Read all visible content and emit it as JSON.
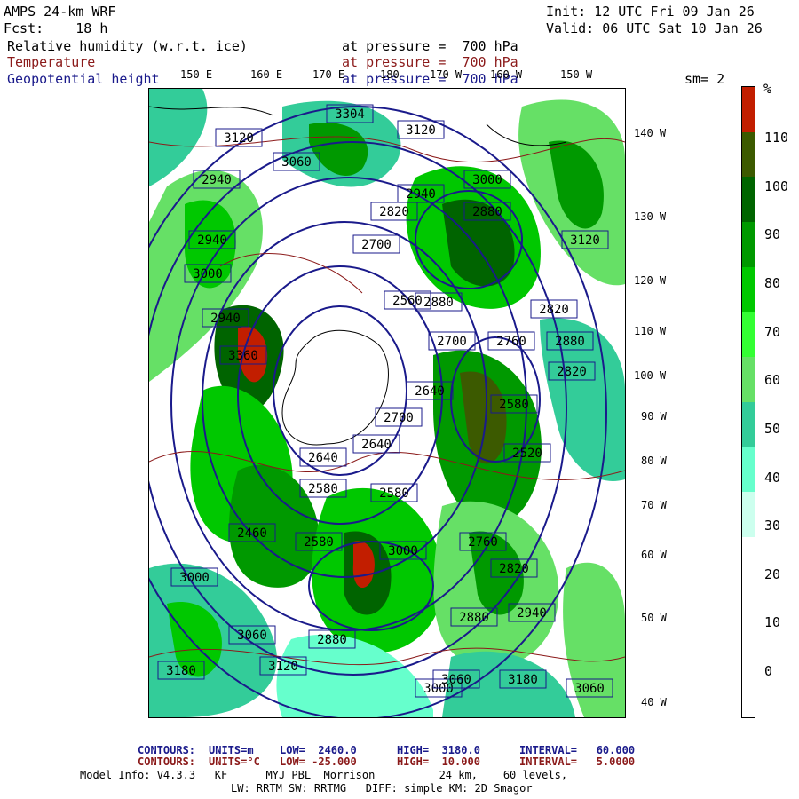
{
  "header": {
    "model": "AMPS 24-km WRF",
    "fcst": "Fcst:    18 h",
    "init": "Init: 12 UTC Fri 09 Jan 26",
    "valid": "Valid: 06 UTC Sat 10 Jan 26",
    "field1_name": "Relative humidity (w.r.t. ice)",
    "field1_level": "at pressure =  700 hPa",
    "field2_name": "Temperature",
    "field2_level": "at pressure =  700 hPa",
    "field3_name": "Geopotential height",
    "field3_level": "at pressure =  700 hPa",
    "smoothing": "sm= 2"
  },
  "map": {
    "top_lon_labels": [
      "150 E",
      "160 E",
      "170 E",
      "180",
      "170 W",
      "160 W",
      "150 W"
    ],
    "right_lon_labels": [
      "140 W",
      "130 W",
      "120 W",
      "110 W",
      "100 W",
      "90 W",
      "80 W",
      "70 W",
      "60 W",
      "50 W",
      "40 W"
    ],
    "height_labels": [
      "3304",
      "3120",
      "3120",
      "3060",
      "3000",
      "2940",
      "2940",
      "2820",
      "2880",
      "2940",
      "3120",
      "3000",
      "2700",
      "2880",
      "2940",
      "2820",
      "2560",
      "2700",
      "2760",
      "2880",
      "2820",
      "2640",
      "2580",
      "2700",
      "2640",
      "2640",
      "2580",
      "2580",
      "2520",
      "2580",
      "2460",
      "2760",
      "2820",
      "2940",
      "3000",
      "2880",
      "3060",
      "3120",
      "3180",
      "2880",
      "3000",
      "3060",
      "3180",
      "3060",
      "3000",
      "3360"
    ],
    "colors": {
      "land_mask": "#ffffff",
      "height_contour": "#1a1a8b",
      "temperature_contour": "#8b1a1a"
    }
  },
  "colorbar": {
    "unit": "%",
    "labels": [
      "110",
      "100",
      "90",
      "80",
      "70",
      "60",
      "50",
      "40",
      "30",
      "20",
      "10",
      "0"
    ],
    "colors": [
      "#c21e00",
      "#3c5a00",
      "#006400",
      "#009900",
      "#00c800",
      "#33ff33",
      "#66e066",
      "#33cc99",
      "#66ffcc",
      "#ccffee",
      "#ffffff",
      "#ffffff",
      "#ffffff",
      "#ffffff"
    ]
  },
  "footer": {
    "c1_label": "CONTOURS:",
    "c1_units": "UNITS=m",
    "c1_low": "LOW=  2460.0",
    "c1_high": "HIGH=  3180.0",
    "c1_interval": "INTERVAL=   60.000",
    "c2_label": "CONTOURS:",
    "c2_units": "UNITS=°C",
    "c2_low": "LOW= -25.000",
    "c2_high": "HIGH=  10.000",
    "c2_interval": "INTERVAL=   5.0000",
    "model_info": "Model Info: V4.3.3   KF      MYJ PBL  Morrison          24 km,    60 levels,",
    "physics": "LW: RRTM SW: RRTMG   DIFF: simple KM: 2D Smagor"
  }
}
